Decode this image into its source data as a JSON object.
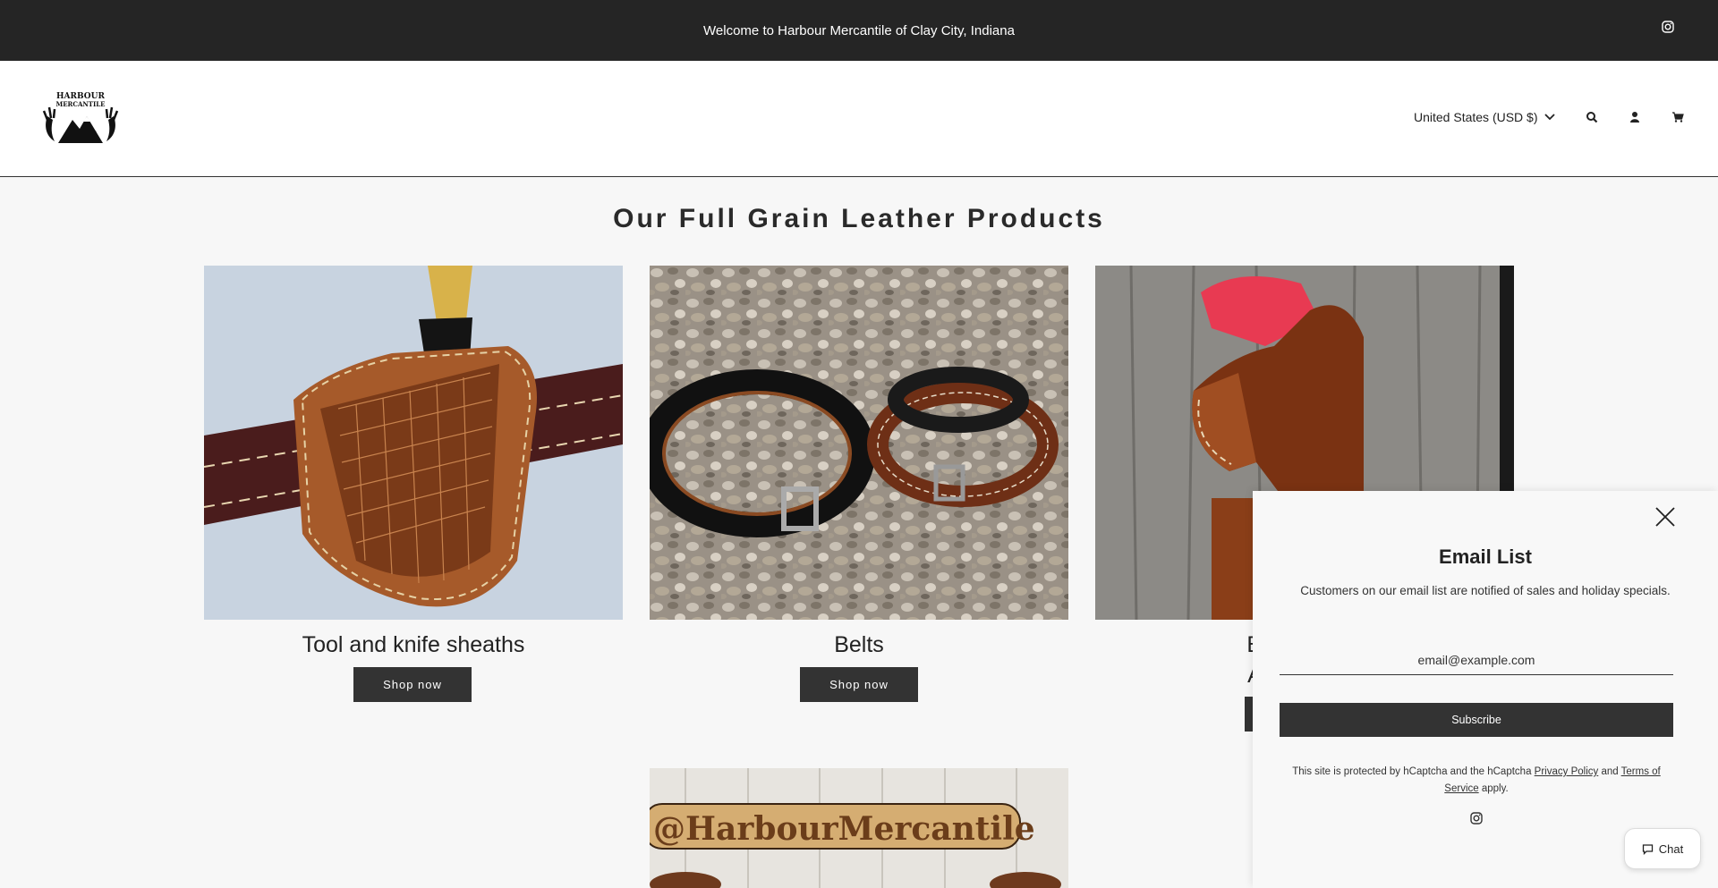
{
  "announcement": {
    "text": "Welcome to Harbour Mercantile of Clay City, Indiana",
    "icon": "instagram-icon"
  },
  "header": {
    "logo_text_line1": "HARBOUR",
    "logo_text_line2": "MERCANTILE",
    "country_selector": "United States (USD $)",
    "icons": [
      "search-icon",
      "account-icon",
      "cart-icon"
    ]
  },
  "main": {
    "title": "Our Full Grain Leather Products",
    "cards": [
      {
        "title": "Tool and knife sheaths",
        "button": "Shop now"
      },
      {
        "title": "Belts",
        "button": "Shop now"
      },
      {
        "title_line1": "Bond Arms,",
        "title_line2": "American A"
      }
    ],
    "bottom_image_text": "@HarbourMercantile"
  },
  "popup": {
    "title": "Email List",
    "description": "Customers on our email list are notified of sales and holiday specials.",
    "email_placeholder": "email@example.com",
    "subscribe_label": "Subscribe",
    "legal_prefix": "This site is protected by hCaptcha and the hCaptcha",
    "privacy_link": "Privacy Policy",
    "legal_and": "and",
    "terms_link": "Terms of Service",
    "legal_suffix": "apply."
  },
  "chat": {
    "label": "Chat"
  },
  "colors": {
    "dark": "#252525",
    "button": "#333333",
    "page_bg": "#f7f7f7"
  }
}
